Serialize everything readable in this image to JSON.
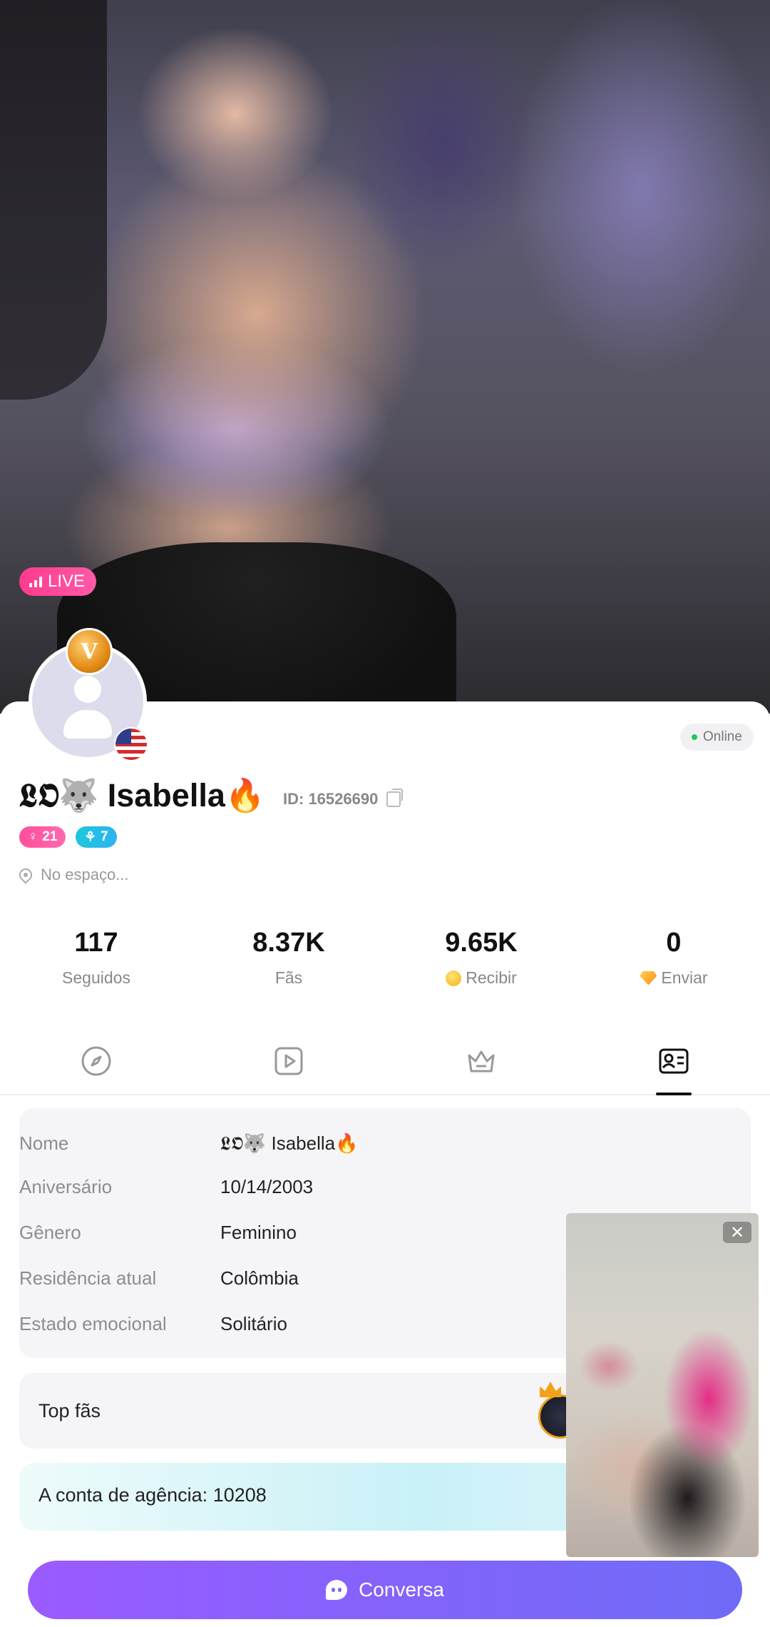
{
  "hero": {
    "live_label": "LIVE"
  },
  "profile": {
    "status": "Online",
    "name": "𝕷𝕺🐺 Isabella🔥",
    "id_label": "ID: 16526690",
    "badges": [
      {
        "icon": "heart-icon",
        "value": "21"
      },
      {
        "icon": "sprout-icon",
        "value": "7"
      }
    ],
    "location": "No espaço...",
    "level_badge": "V"
  },
  "stats": [
    {
      "value": "117",
      "label": "Seguidos"
    },
    {
      "value": "8.37K",
      "label": "Fãs"
    },
    {
      "value": "9.65K",
      "label": "Recibir"
    },
    {
      "value": "0",
      "label": "Enviar"
    }
  ],
  "tabs": [
    {
      "icon": "compass-icon",
      "active": false
    },
    {
      "icon": "video-play-icon",
      "active": false
    },
    {
      "icon": "crown-icon",
      "active": false
    },
    {
      "icon": "profile-card-icon",
      "active": true
    }
  ],
  "info": [
    {
      "key": "Nome",
      "value": "𝕷𝕺🐺 Isabella🔥"
    },
    {
      "key": "Aniversário",
      "value": "10/14/2003"
    },
    {
      "key": "Gênero",
      "value": "Feminino"
    },
    {
      "key": "Residência atual",
      "value": "Colômbia"
    },
    {
      "key": "Estado emocional",
      "value": "Solitário"
    }
  ],
  "top_fans": {
    "label": "Top fãs"
  },
  "agency": {
    "label": "A conta de agência: 10208"
  },
  "floating_video": {
    "close_label": "✕"
  },
  "chat_button": {
    "label": "Conversa"
  },
  "colors": {
    "accent": "#7f67fb",
    "live": "#ff3a8c",
    "online": "#22c55e"
  }
}
